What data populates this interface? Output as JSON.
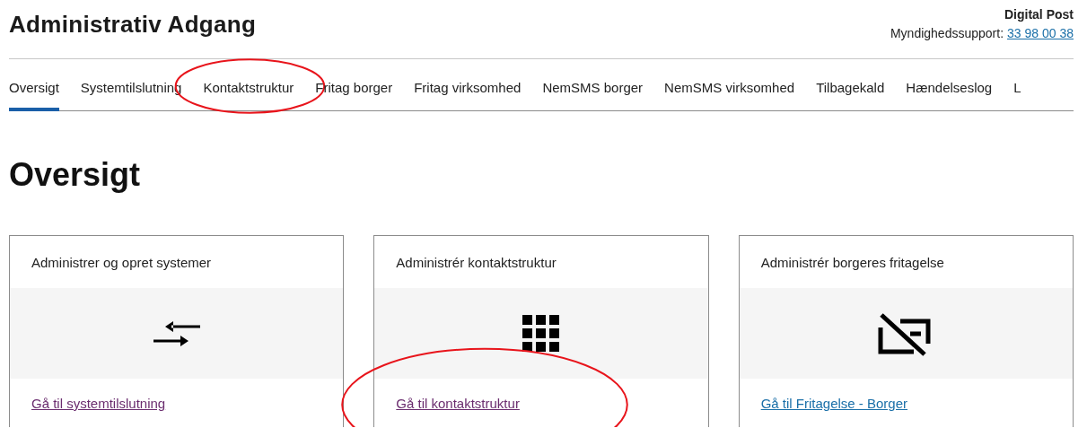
{
  "header": {
    "title": "Administrativ Adgang",
    "service": "Digital Post",
    "support_label": "Myndighedssupport:",
    "support_phone": "33 98 00 38"
  },
  "tabs": [
    {
      "label": "Oversigt",
      "selected": true,
      "circled": false
    },
    {
      "label": "Systemtilslutning",
      "selected": false,
      "circled": false
    },
    {
      "label": "Kontaktstruktur",
      "selected": false,
      "circled": true
    },
    {
      "label": "Fritag borger",
      "selected": false,
      "circled": false
    },
    {
      "label": "Fritag virksomhed",
      "selected": false,
      "circled": false
    },
    {
      "label": "NemSMS borger",
      "selected": false,
      "circled": false
    },
    {
      "label": "NemSMS virksomhed",
      "selected": false,
      "circled": false
    },
    {
      "label": "Tilbagekald",
      "selected": false,
      "circled": false
    },
    {
      "label": "Hændelseslog",
      "selected": false,
      "circled": false
    },
    {
      "label": "L",
      "selected": false,
      "circled": false
    }
  ],
  "heading": "Oversigt",
  "cards": [
    {
      "title": "Administrer og opret systemer",
      "kind": "arrows",
      "link": "Gå til systemtilslutning",
      "visited": true,
      "circled": false
    },
    {
      "title": "Administrér kontaktstruktur",
      "kind": "grid",
      "link": "Gå til kontaktstruktur",
      "visited": true,
      "circled": true
    },
    {
      "title": "Administrér borgeres fritagelse",
      "kind": "no-screen",
      "link": "Gå til Fritagelse - Borger",
      "visited": false,
      "circled": false
    }
  ]
}
